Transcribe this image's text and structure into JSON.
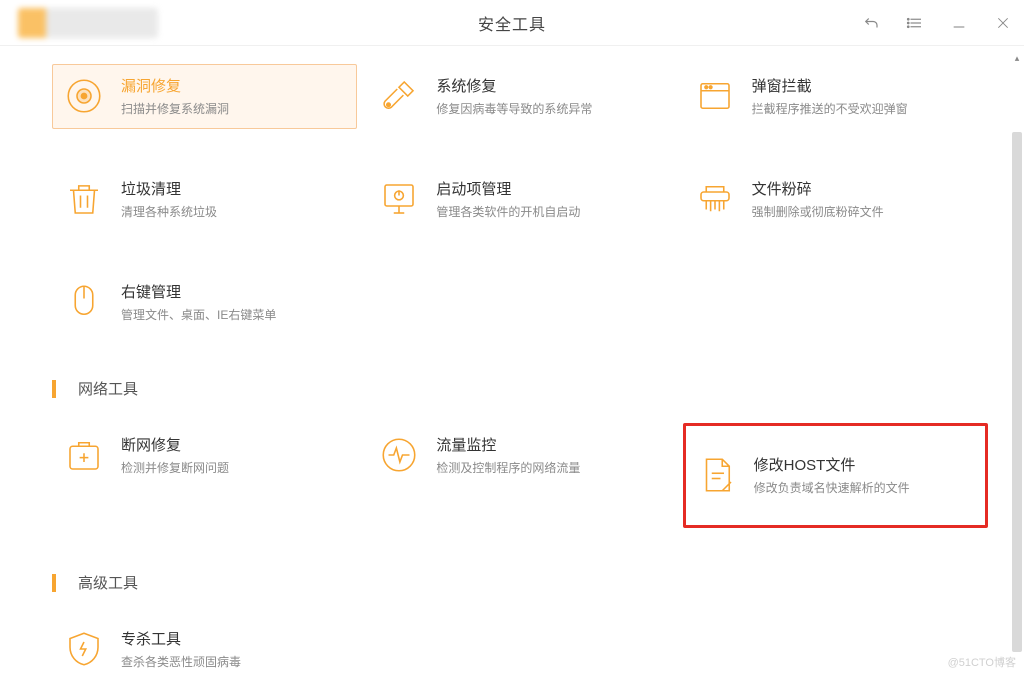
{
  "window": {
    "title": "安全工具"
  },
  "tools_row1": [
    {
      "title": "漏洞修复",
      "desc": "扫描并修复系统漏洞",
      "icon": "target-icon",
      "active": true
    },
    {
      "title": "系统修复",
      "desc": "修复因病毒等导致的系统异常",
      "icon": "wrench-icon"
    },
    {
      "title": "弹窗拦截",
      "desc": "拦截程序推送的不受欢迎弹窗",
      "icon": "window-block-icon"
    }
  ],
  "tools_row2": [
    {
      "title": "垃圾清理",
      "desc": "清理各种系统垃圾",
      "icon": "trash-icon"
    },
    {
      "title": "启动项管理",
      "desc": "管理各类软件的开机自启动",
      "icon": "monitor-power-icon"
    },
    {
      "title": "文件粉碎",
      "desc": "强制删除或彻底粉碎文件",
      "icon": "shredder-icon"
    }
  ],
  "tools_row3": [
    {
      "title": "右键管理",
      "desc": "管理文件、桌面、IE右键菜单",
      "icon": "mouse-icon"
    }
  ],
  "section_network": "网络工具",
  "tools_network": [
    {
      "title": "断网修复",
      "desc": "检测并修复断网问题",
      "icon": "firstaid-icon"
    },
    {
      "title": "流量监控",
      "desc": "检测及控制程序的网络流量",
      "icon": "pulse-icon"
    },
    {
      "title": "修改HOST文件",
      "desc": "修改负责域名快速解析的文件",
      "icon": "file-edit-icon",
      "highlight": true
    }
  ],
  "section_advanced": "高级工具",
  "tools_advanced": [
    {
      "title": "专杀工具",
      "desc": "查杀各类恶性顽固病毒",
      "icon": "shield-bolt-icon"
    }
  ],
  "watermark": "@51CTO博客"
}
